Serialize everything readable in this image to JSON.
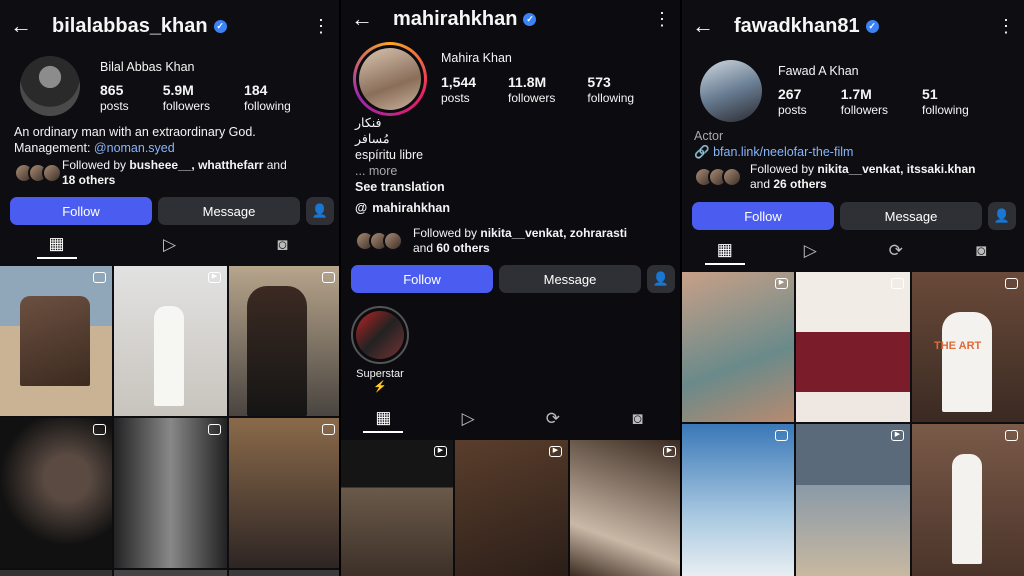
{
  "s1": {
    "username": "bilalabbas_khan",
    "full_name": "Bilal Abbas Khan",
    "stats": [
      {
        "value": "865",
        "label": "posts"
      },
      {
        "value": "5.9M",
        "label": "followers"
      },
      {
        "value": "184",
        "label": "following"
      }
    ],
    "bio_line1": "An ordinary man with an extraordinary God.",
    "bio_mgmt_prefix": "Management: ",
    "bio_mgmt_handle": "@noman.syed",
    "followed_by_prefix": "Followed by ",
    "followed_by_names": "busheee__, whatthefarr",
    "followed_by_mid": " and",
    "followed_by_others": "18 others",
    "follow_label": "Follow",
    "message_label": "Message"
  },
  "s2": {
    "username": "mahirahkhan",
    "full_name": "Mahira Khan",
    "stats": [
      {
        "value": "1,544",
        "label": "posts"
      },
      {
        "value": "11.8M",
        "label": "followers"
      },
      {
        "value": "573",
        "label": "following"
      }
    ],
    "bio_line1": "فنکار",
    "bio_line2": "مُسافر",
    "bio_line3": "espíritu libre",
    "more": "... more",
    "see_translation": "See translation",
    "threads_handle": "mahirahkhan",
    "followed_by_prefix": "Followed by ",
    "followed_by_names": "nikita__venkat, zohrarasti",
    "followed_by_mid": "and ",
    "followed_by_others": "60 others",
    "follow_label": "Follow",
    "message_label": "Message",
    "highlight_label": "Superstar ⚡"
  },
  "s3": {
    "username": "fawadkhan81",
    "full_name": "Fawad A Khan",
    "stats": [
      {
        "value": "267",
        "label": "posts"
      },
      {
        "value": "1.7M",
        "label": "followers"
      },
      {
        "value": "51",
        "label": "following"
      }
    ],
    "category": "Actor",
    "link": "bfan.link/neelofar-the-film",
    "followed_by_prefix": "Followed by ",
    "followed_by_names": "nikita__venkat, itssaki.khan",
    "followed_by_mid": "and ",
    "followed_by_others": "26 others",
    "follow_label": "Follow",
    "message_label": "Message",
    "post_text": "THE ART"
  },
  "icons": {
    "back": "arrow-left-icon",
    "more": "kebab-icon",
    "verified": "verified-badge-icon",
    "grid": "grid-icon",
    "reels": "reels-icon",
    "reposts": "repost-icon",
    "tagged": "tagged-icon",
    "add_user": "add-user-icon",
    "threads": "threads-icon",
    "link": "link-icon"
  },
  "colors": {
    "follow": "#4a5df0",
    "message": "#2f3036",
    "link": "#8ab4f8",
    "verified": "#3b82f6"
  }
}
